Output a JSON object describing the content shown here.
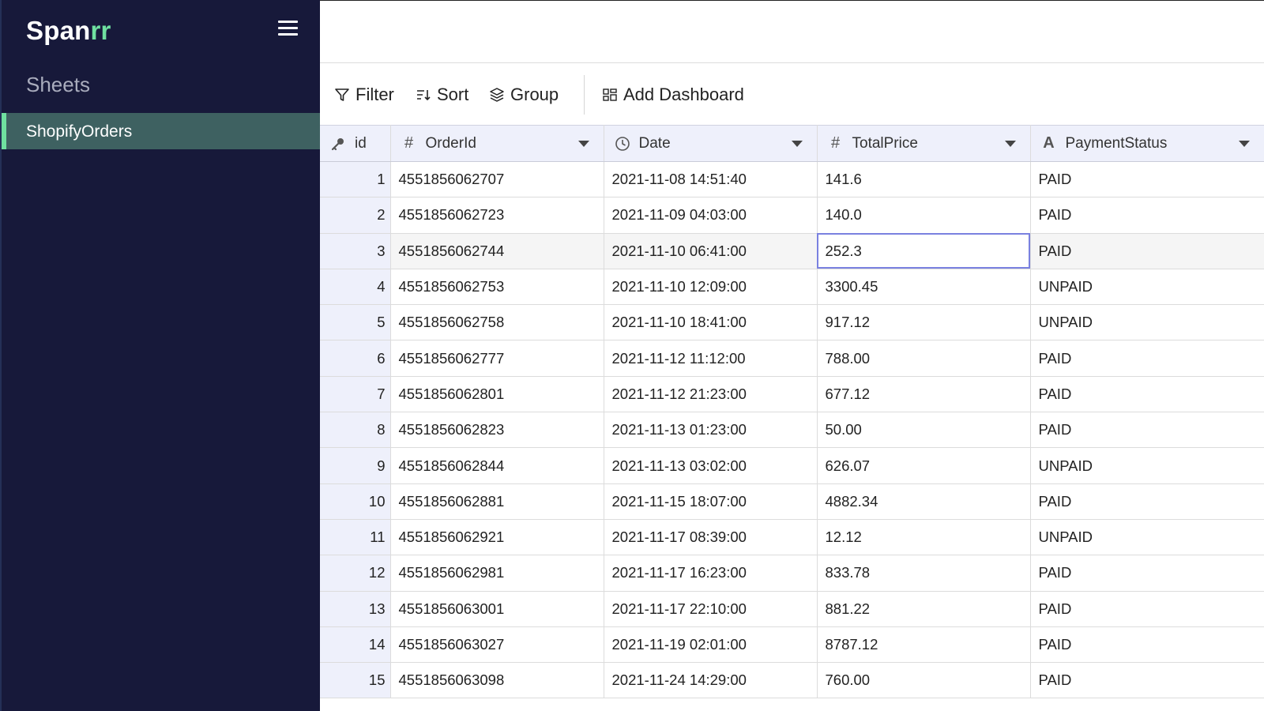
{
  "sidebar": {
    "brand_main": "Span",
    "brand_accent": "rr",
    "sheets_heading": "Sheets",
    "sheets": [
      {
        "label": "ShopifyOrders",
        "active": true
      }
    ]
  },
  "toolbar": {
    "filter_label": "Filter",
    "sort_label": "Sort",
    "group_label": "Group",
    "add_dashboard_label": "Add Dashboard"
  },
  "table": {
    "columns": [
      {
        "label": "id",
        "icon": "key-icon"
      },
      {
        "label": "OrderId",
        "icon": "hash-icon"
      },
      {
        "label": "Date",
        "icon": "clock-icon"
      },
      {
        "label": "TotalPrice",
        "icon": "hash-icon"
      },
      {
        "label": "PaymentStatus",
        "icon": "text-type-icon"
      }
    ],
    "rows": [
      {
        "id": "1",
        "order_id": "4551856062707",
        "date": "2021-11-08 14:51:40",
        "total_price": "141.6",
        "payment_status": "PAID"
      },
      {
        "id": "2",
        "order_id": "4551856062723",
        "date": "2021-11-09 04:03:00",
        "total_price": "140.0",
        "payment_status": "PAID"
      },
      {
        "id": "3",
        "order_id": "4551856062744",
        "date": "2021-11-10 06:41:00",
        "total_price": "252.3",
        "payment_status": "PAID"
      },
      {
        "id": "4",
        "order_id": "4551856062753",
        "date": "2021-11-10 12:09:00",
        "total_price": "3300.45",
        "payment_status": "UNPAID"
      },
      {
        "id": "5",
        "order_id": "4551856062758",
        "date": "2021-11-10 18:41:00",
        "total_price": "917.12",
        "payment_status": "UNPAID"
      },
      {
        "id": "6",
        "order_id": "4551856062777",
        "date": "2021-11-12 11:12:00",
        "total_price": "788.00",
        "payment_status": "PAID"
      },
      {
        "id": "7",
        "order_id": "4551856062801",
        "date": "2021-11-12 21:23:00",
        "total_price": "677.12",
        "payment_status": "PAID"
      },
      {
        "id": "8",
        "order_id": "4551856062823",
        "date": "2021-11-13 01:23:00",
        "total_price": "50.00",
        "payment_status": "PAID"
      },
      {
        "id": "9",
        "order_id": "4551856062844",
        "date": "2021-11-13 03:02:00",
        "total_price": "626.07",
        "payment_status": "UNPAID"
      },
      {
        "id": "10",
        "order_id": "4551856062881",
        "date": "2021-11-15 18:07:00",
        "total_price": "4882.34",
        "payment_status": "PAID"
      },
      {
        "id": "11",
        "order_id": "4551856062921",
        "date": "2021-11-17 08:39:00",
        "total_price": "12.12",
        "payment_status": "UNPAID"
      },
      {
        "id": "12",
        "order_id": "4551856062981",
        "date": "2021-11-17 16:23:00",
        "total_price": "833.78",
        "payment_status": "PAID"
      },
      {
        "id": "13",
        "order_id": "4551856063001",
        "date": "2021-11-17 22:10:00",
        "total_price": "881.22",
        "payment_status": "PAID"
      },
      {
        "id": "14",
        "order_id": "4551856063027",
        "date": "2021-11-19 02:01:00",
        "total_price": "8787.12",
        "payment_status": "PAID"
      },
      {
        "id": "15",
        "order_id": "4551856063098",
        "date": "2021-11-24 14:29:00",
        "total_price": "760.00",
        "payment_status": "PAID"
      }
    ],
    "selected_row_index": 2,
    "selected_column": "total_price"
  },
  "colors": {
    "sidebar_bg": "#17193a",
    "active_sheet_bg": "#3e6161",
    "accent": "#6fe0a0",
    "header_bg": "#eef0fb",
    "selection_outline": "#7a81e0"
  }
}
